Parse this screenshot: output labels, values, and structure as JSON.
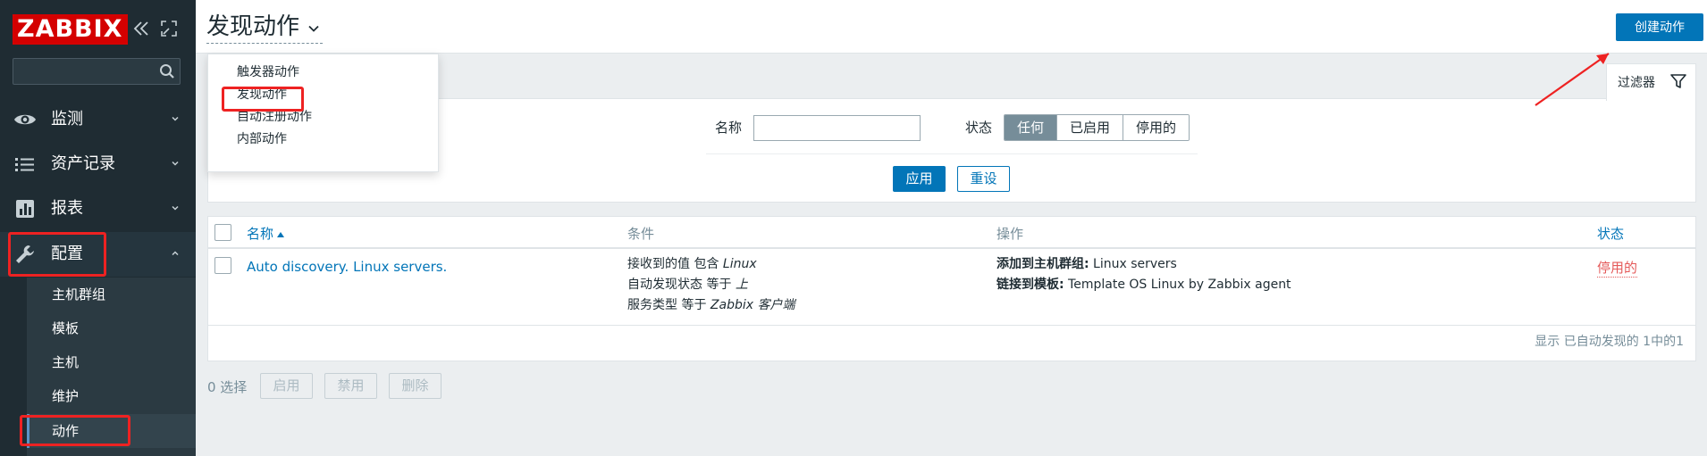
{
  "sidebar": {
    "logo": "ZABBIX",
    "search_placeholder": "",
    "nav": [
      {
        "label": "监测",
        "icon": "eye-icon"
      },
      {
        "label": "资产记录",
        "icon": "list-icon"
      },
      {
        "label": "报表",
        "icon": "bar-chart-icon"
      },
      {
        "label": "配置",
        "icon": "wrench-icon"
      }
    ],
    "submenu": [
      "主机群组",
      "模板",
      "主机",
      "维护",
      "动作"
    ]
  },
  "header": {
    "title": "发现动作",
    "create_button": "创建动作"
  },
  "dropdown": {
    "items": [
      "触发器动作",
      "发现动作",
      "自动注册动作",
      "内部动作"
    ]
  },
  "filter": {
    "tab_label": "过滤器",
    "name_label": "名称",
    "name_value": "",
    "status_label": "状态",
    "status_options": [
      "任何",
      "已启用",
      "停用的"
    ],
    "status_selected": "任何",
    "apply": "应用",
    "reset": "重设"
  },
  "table": {
    "columns": [
      "名称",
      "条件",
      "操作",
      "状态"
    ],
    "rows": [
      {
        "name": "Auto discovery. Linux servers.",
        "conditions": [
          {
            "text": "接收到的值 包含 ",
            "value": "Linux"
          },
          {
            "text": "自动发现状态 等于 ",
            "value": "上"
          },
          {
            "text": "服务类型 等于 ",
            "value": "Zabbix 客户端"
          }
        ],
        "operations": [
          {
            "label": "添加到主机群组:",
            "value": " Linux servers"
          },
          {
            "label": "链接到模板:",
            "value": " Template OS Linux by Zabbix agent"
          }
        ],
        "status": "停用的"
      }
    ],
    "footer": "显示 已自动发现的 1中的1"
  },
  "actions_bar": {
    "selected": "0 选择",
    "buttons": [
      "启用",
      "禁用",
      "删除"
    ]
  },
  "colors": {
    "sidebar_bg": "#1f2c33",
    "accent": "#0275b8",
    "disabled_status": "#e45959",
    "logo_red": "#d40000",
    "annotation_red": "#ee2222"
  }
}
